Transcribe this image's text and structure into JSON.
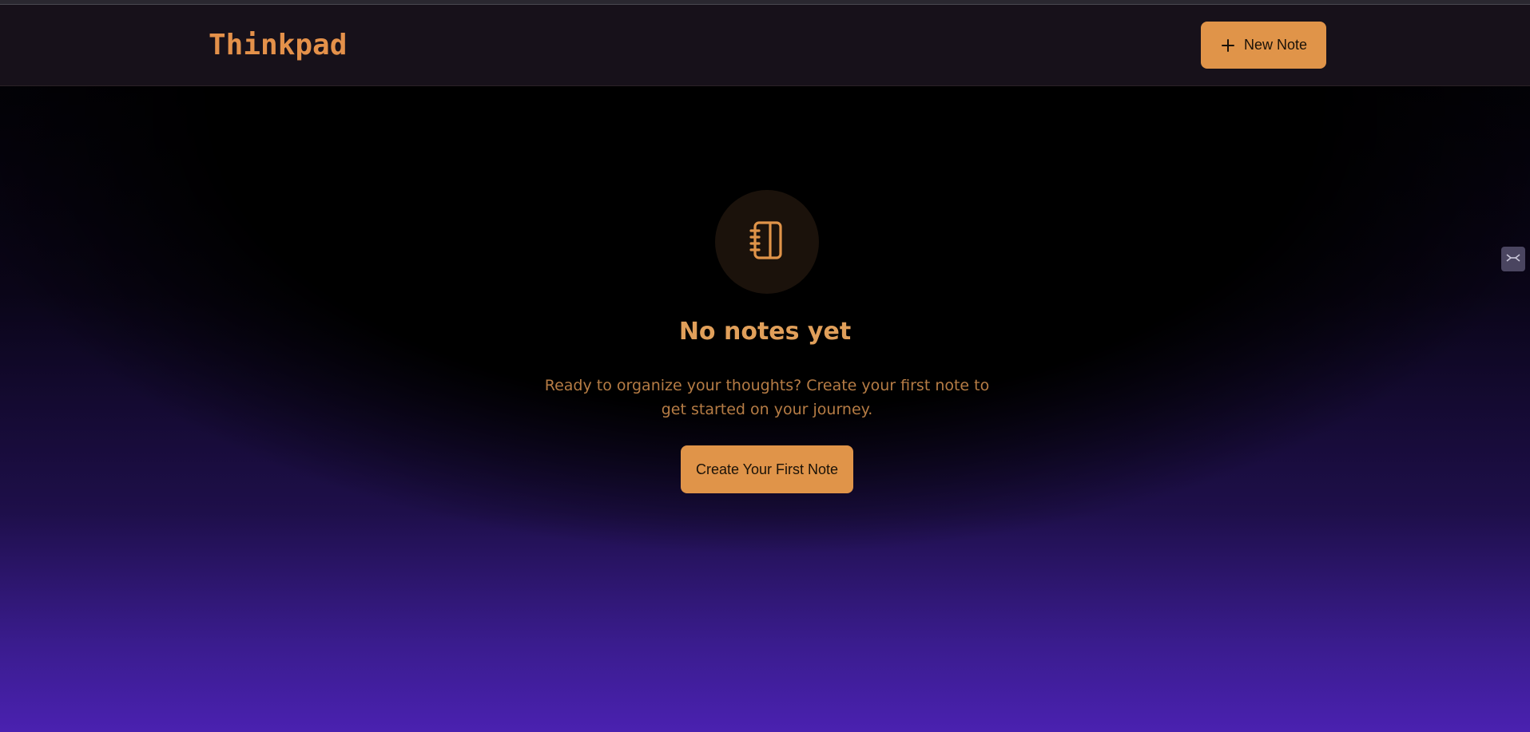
{
  "app": {
    "title": "Thinkpad"
  },
  "header": {
    "new_note_label": "New Note",
    "new_note_icon": "plus-icon"
  },
  "empty_state": {
    "icon": "notebook-icon",
    "title": "No notes yet",
    "description": "Ready to organize your thoughts? Create your first note to get started on your journey.",
    "cta_label": "Create Your First Note"
  },
  "side_widget": {
    "icon": "collapse-icon"
  },
  "colors": {
    "accent": "#e09449",
    "header_bg": "#17111a",
    "title_text": "#e09f5a",
    "desc_text": "#b67c45",
    "gradient_bottom": "#4a21b0"
  }
}
